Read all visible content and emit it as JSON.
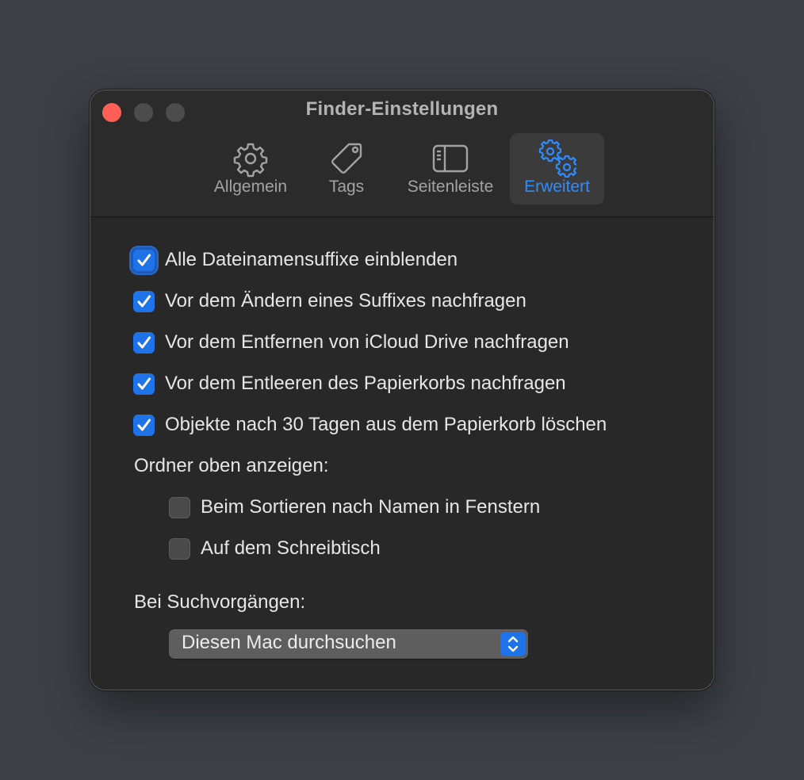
{
  "window": {
    "title": "Finder-Einstellungen"
  },
  "tabs": [
    {
      "label": "Allgemein",
      "icon": "gear-icon",
      "selected": false
    },
    {
      "label": "Tags",
      "icon": "tag-icon",
      "selected": false
    },
    {
      "label": "Seitenleiste",
      "icon": "sidebar-icon",
      "selected": false
    },
    {
      "label": "Erweitert",
      "icon": "gears-icon",
      "selected": true
    }
  ],
  "options": [
    {
      "label": "Alle Dateinamensuffixe einblenden",
      "checked": true
    },
    {
      "label": "Vor dem Ändern eines Suffixes nachfragen",
      "checked": true
    },
    {
      "label": "Vor dem Entfernen von iCloud Drive nachfragen",
      "checked": true
    },
    {
      "label": "Vor dem Entleeren des Papierkorbs nachfragen",
      "checked": true
    },
    {
      "label": "Objekte nach 30 Tagen aus dem Papierkorb löschen",
      "checked": true
    }
  ],
  "folders_section": {
    "label": "Ordner oben anzeigen:",
    "options": [
      {
        "label": "Beim Sortieren nach Namen in Fenstern",
        "checked": false
      },
      {
        "label": "Auf dem Schreibtisch",
        "checked": false
      }
    ]
  },
  "search_section": {
    "label": "Bei Suchvorgängen:",
    "selected": "Diesen Mac durchsuchen"
  },
  "colors": {
    "accent": "#1f73e8",
    "selected_tab_text": "#2f8cff",
    "close_button": "#fe5f57"
  }
}
